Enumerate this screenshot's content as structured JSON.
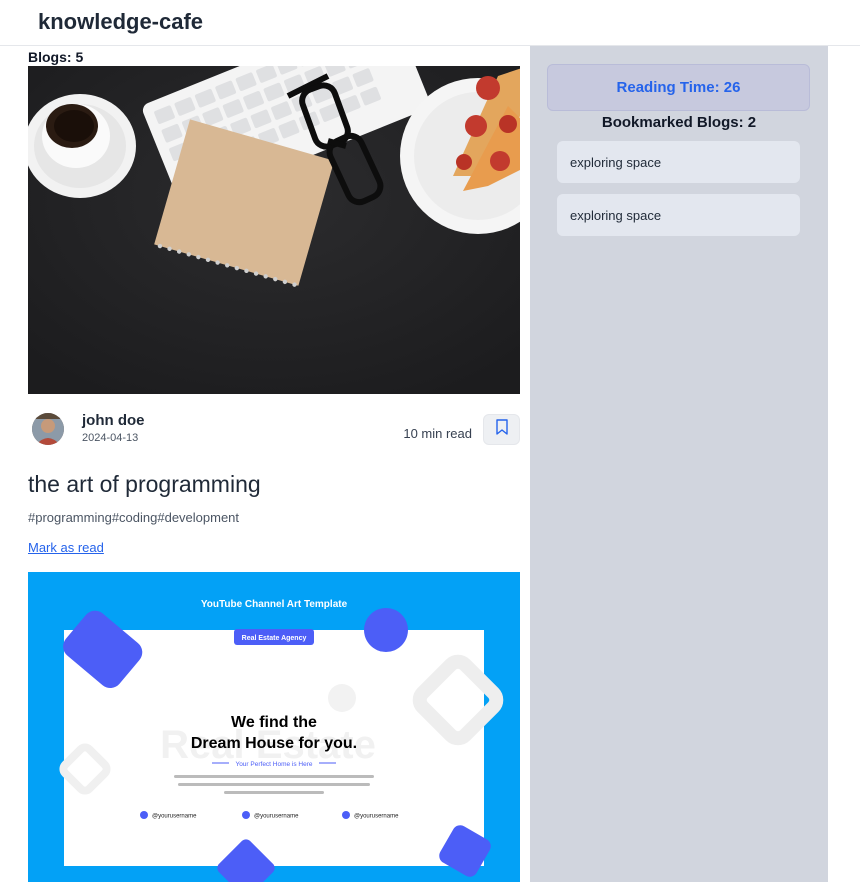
{
  "header": {
    "title": "knowledge-cafe"
  },
  "main": {
    "blogs_count": "Blogs: 5",
    "post": {
      "author": "john doe",
      "date": "2024-04-13",
      "read_time": "10 min read",
      "title": "the art of programming",
      "tags": "#programming#coding#development",
      "mark_read": "Mark as read"
    },
    "next_cover": {
      "heading": "YouTube Channel Art Template",
      "badge": "Real Estate Agency",
      "headline_line1": "We find the",
      "headline_line2": "Dream House for you.",
      "tagline": "Your Perfect Home is Here",
      "watermark": "Real Estate",
      "social1": "@yourusername",
      "social2": "@yourusername",
      "social3": "@yourusername"
    }
  },
  "sidebar": {
    "reading_time": "Reading Time: 26",
    "bookmarked_title": "Bookmarked Blogs: 2",
    "bookmarks": [
      "exploring space",
      "exploring space"
    ]
  },
  "colors": {
    "accent": "#2563eb",
    "sidebar_bg": "#d1d5de",
    "cover2_bg": "#03a1f6",
    "shape_blue": "#4c5ef7"
  },
  "icons": {
    "bookmark": "bookmark-icon"
  }
}
